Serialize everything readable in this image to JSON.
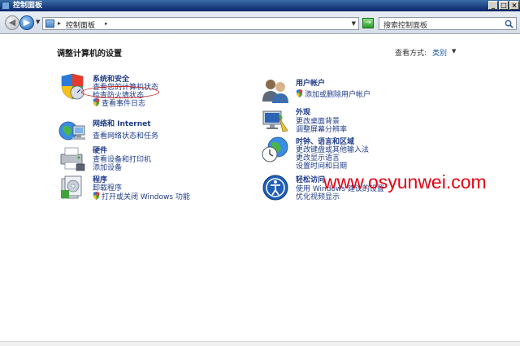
{
  "window": {
    "title": "控制面板",
    "minimize_icon": "minimize-icon",
    "maximize_icon": "maximize-icon",
    "close_icon": "close-icon"
  },
  "navbar": {
    "breadcrumb": "控制面板",
    "search_placeholder": "搜索控制面板"
  },
  "main": {
    "heading": "调整计算机的设置",
    "view_by_label": "查看方式:",
    "view_by_value": "类别"
  },
  "categories": [
    {
      "title": "系统和安全",
      "icon": "system-security-icon",
      "links": [
        "查看您的计算机状态",
        "检查防火墙状态",
        "查看事件日志"
      ]
    },
    {
      "title": "网络和 Internet",
      "icon": "network-icon",
      "links": [
        "查看网络状态和任务"
      ]
    },
    {
      "title": "硬件",
      "icon": "hardware-printer-icon",
      "links": [
        "查看设备和打印机",
        "添加设备"
      ]
    },
    {
      "title": "程序",
      "icon": "programs-icon",
      "links": [
        "卸载程序",
        "打开或关闭 Windows 功能"
      ]
    },
    {
      "title": "用户帐户",
      "icon": "user-accounts-icon",
      "links": [
        "添加或删除用户帐户"
      ]
    },
    {
      "title": "外观",
      "icon": "appearance-icon",
      "links": [
        "更改桌面背景",
        "调整屏幕分辨率"
      ]
    },
    {
      "title": "时钟、语言和区域",
      "icon": "clock-language-region-icon",
      "links": [
        "更改键盘或其他输入法",
        "更改显示语言",
        "设置时间和日期"
      ]
    },
    {
      "title": "轻松访问",
      "icon": "ease-of-access-icon",
      "links": [
        "使用 Windows 建议的设置",
        "优化视频显示"
      ]
    }
  ],
  "watermark": "www.osyunwei.com",
  "colors": {
    "link": "#1e3b8a",
    "titlebar": "#0a246a",
    "highlight_oval": "#c81d1d",
    "watermark": "#e60012"
  }
}
